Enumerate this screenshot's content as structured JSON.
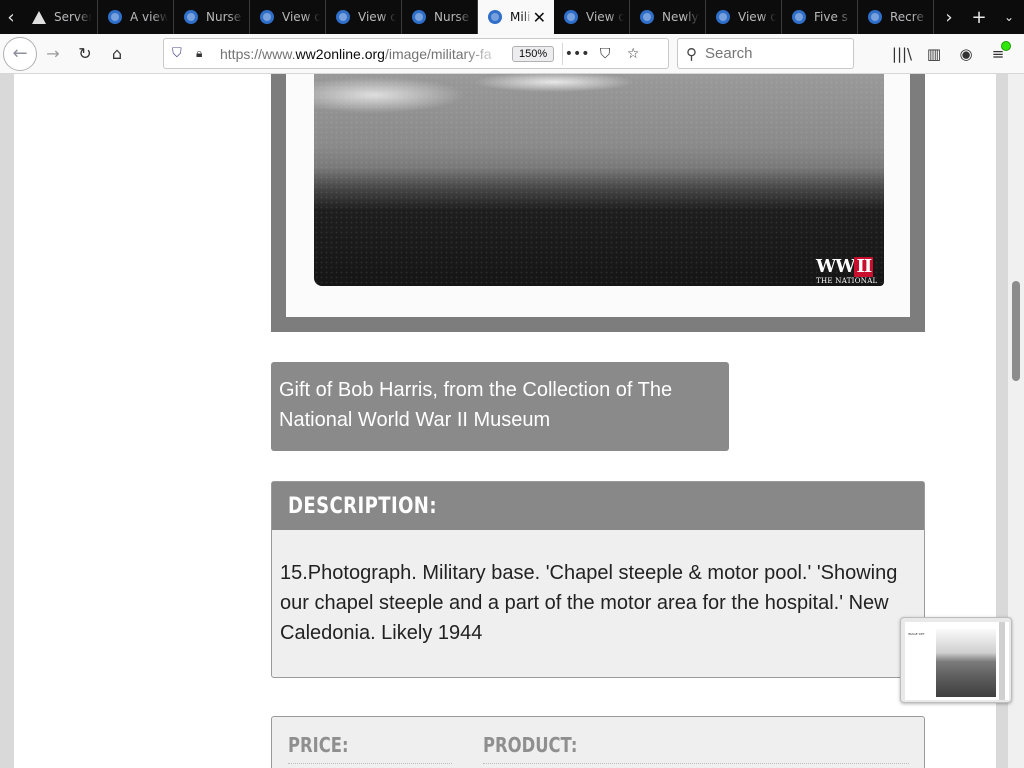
{
  "browser": {
    "tabs": [
      {
        "label": "Server",
        "icon": "warning-icon",
        "active": false
      },
      {
        "label": "A view",
        "icon": "globe-icon",
        "active": false
      },
      {
        "label": "Nurse",
        "icon": "globe-icon",
        "active": false
      },
      {
        "label": "View o",
        "icon": "globe-icon",
        "active": false
      },
      {
        "label": "View o",
        "icon": "globe-icon",
        "active": false
      },
      {
        "label": "Nurse",
        "icon": "globe-icon",
        "active": false
      },
      {
        "label": "Mili",
        "icon": "globe-icon",
        "active": true
      },
      {
        "label": "View o",
        "icon": "globe-icon",
        "active": false
      },
      {
        "label": "Newly",
        "icon": "globe-icon",
        "active": false
      },
      {
        "label": "View o",
        "icon": "globe-icon",
        "active": false
      },
      {
        "label": "Five s",
        "icon": "globe-icon",
        "active": false
      },
      {
        "label": "Recre",
        "icon": "globe-icon",
        "active": false
      }
    ],
    "url_prefix": "https://www.",
    "url_host": "ww2online.org",
    "url_path": "/image/military-fa",
    "zoom": "150%",
    "search_placeholder": "Search"
  },
  "page": {
    "credit": "Gift of Bob Harris, from the Collection of The National World War II Museum",
    "description_title": "DESCRIPTION:",
    "description_text": "15.Photograph. Military base. 'Chapel steeple & motor pool.' 'Showing our chapel steeple and a part of the motor area for the hospital.' New Caledonia. Likely 1944",
    "price_label": "PRICE:",
    "product_label": "PRODUCT:",
    "watermark": {
      "mark_left": "WW",
      "mark_right": "II",
      "sub": "THE NATIONAL"
    }
  },
  "thumbnail": {
    "heading": "IMAGE DET"
  },
  "colors": {
    "accent_gray": "#888888",
    "logo_red": "#c8102e",
    "addon_badge": "#30e60b"
  }
}
